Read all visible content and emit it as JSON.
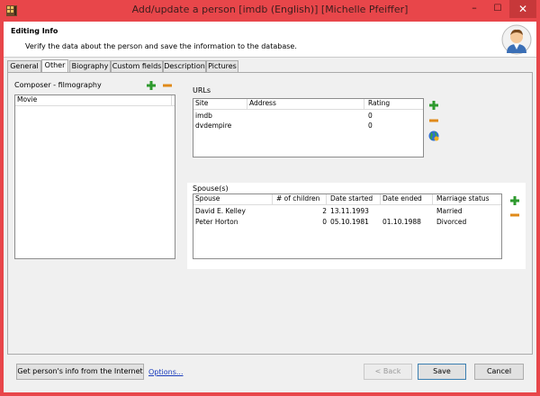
{
  "window": {
    "title": "Add/update a person [imdb (English)] [Michelle Pfeiffer]",
    "minimize": "–",
    "maximize": "☐",
    "close": "✕"
  },
  "header": {
    "title": "Editing Info",
    "subtitle": "Verify the data about the person and save the information to the database."
  },
  "tabs": [
    {
      "label": "General"
    },
    {
      "label": "Other"
    },
    {
      "label": "Biography"
    },
    {
      "label": "Custom fields"
    },
    {
      "label": "Description"
    },
    {
      "label": "Pictures"
    }
  ],
  "active_tab": "Other",
  "composer": {
    "label": "Composer - filmography",
    "column": "Movie"
  },
  "urls": {
    "label": "URLs",
    "columns": [
      "Site",
      "Address",
      "Rating"
    ],
    "rows": [
      {
        "site": "imdb",
        "address": "",
        "rating": "0"
      },
      {
        "site": "dvdempire",
        "address": "",
        "rating": "0"
      }
    ]
  },
  "spouses": {
    "label": "Spouse(s)",
    "columns": [
      "Spouse",
      "# of children",
      "Date started",
      "Date ended",
      "Marriage status"
    ],
    "rows": [
      {
        "spouse": "David E. Kelley",
        "children": "2",
        "started": "13.11.1993",
        "ended": "",
        "status": "Married"
      },
      {
        "spouse": "Peter Horton",
        "children": "0",
        "started": "05.10.1981",
        "ended": "01.10.1988",
        "status": "Divorced"
      }
    ]
  },
  "buttons": {
    "internet": "Get person's info from the Internet",
    "options": "Options...",
    "back": "< Back",
    "save": "Save",
    "cancel": "Cancel"
  },
  "colors": {
    "titlebar": "#e8464a",
    "close_button": "#c7383a",
    "link": "#1a3cbd",
    "plus_icon": "#2e9a2e",
    "minus_icon": "#e08a1a"
  }
}
